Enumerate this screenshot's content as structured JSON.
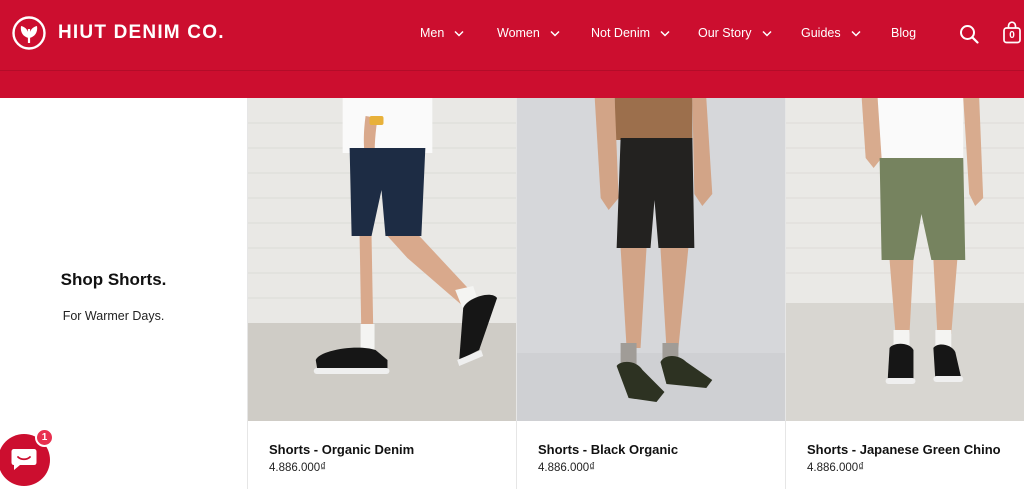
{
  "brand": {
    "name": "HIUT DENIM CO."
  },
  "nav": {
    "items": [
      {
        "label": "Men",
        "has_dropdown": true
      },
      {
        "label": "Women",
        "has_dropdown": true
      },
      {
        "label": "Not Denim",
        "has_dropdown": true
      },
      {
        "label": "Our Story",
        "has_dropdown": true
      },
      {
        "label": "Guides",
        "has_dropdown": true
      },
      {
        "label": "Blog",
        "has_dropdown": false
      }
    ],
    "search_icon": "search-icon",
    "cart_icon": "shopping-bag-icon",
    "cart_count": "0"
  },
  "promo": {
    "title": "Shop Shorts.",
    "subtitle": "For Warmer Days."
  },
  "products": [
    {
      "name": "Shorts - Organic Denim",
      "price": "4.886.000₫",
      "short_color": "#1d2c44"
    },
    {
      "name": "Shorts - Black Organic",
      "price": "4.886.000₫",
      "short_color": "#232220"
    },
    {
      "name": "Shorts - Japanese Green Chino",
      "price": "4.886.000₫",
      "short_color": "#76835f"
    }
  ],
  "chat": {
    "icon": "chat-icon",
    "badge": "1"
  },
  "colors": {
    "brand_red": "#cc0e2f",
    "badge_red": "#e8304f"
  }
}
